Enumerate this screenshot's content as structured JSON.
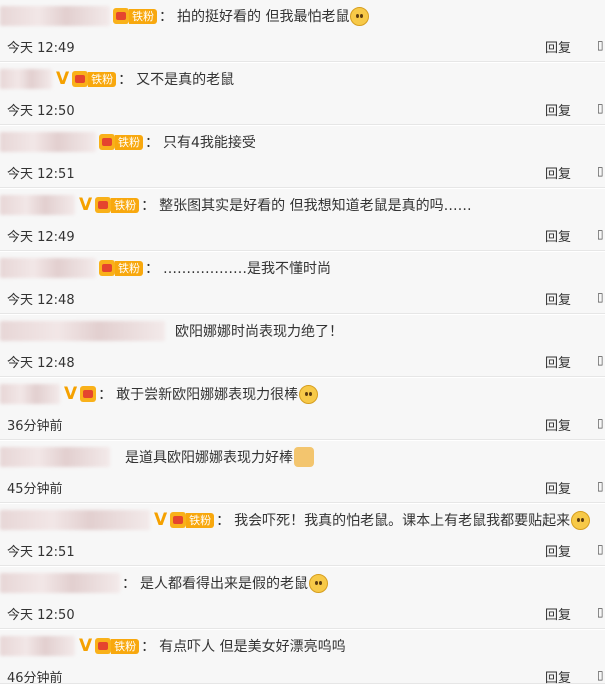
{
  "fan_badge_text": "铁粉",
  "v_badge": "V",
  "reply_label": "回复",
  "thumb_glyph": "▯",
  "comments": [
    {
      "text": "拍的挺好看的 但我最怕老鼠",
      "time": "今天 12:49",
      "v": false,
      "fan": true
    },
    {
      "text": "又不是真的老鼠",
      "time": "今天 12:50",
      "v": true,
      "fan": true
    },
    {
      "text": "只有4我能接受",
      "time": "今天 12:51",
      "v": false,
      "fan": true
    },
    {
      "text": "整张图其实是好看的 但我想知道老鼠是真的吗……",
      "time": "今天 12:49",
      "v": true,
      "fan": true
    },
    {
      "text": "………………是我不懂时尚",
      "time": "今天 12:48",
      "v": false,
      "fan": true
    },
    {
      "text": "欧阳娜娜时尚表现力绝了！",
      "time": "今天 12:48",
      "v": false,
      "fan": false
    },
    {
      "text": "敢于尝新欧阳娜娜表现力很棒",
      "time": "36分钟前",
      "v": true,
      "fan": true
    },
    {
      "text": "是道具欧阳娜娜表现力好棒",
      "time": "45分钟前",
      "v": false,
      "fan": false
    },
    {
      "text": "我会吓死！我真的怕老鼠。课本上有老鼠我都要贴起来",
      "time": "今天 12:51",
      "v": true,
      "fan": true
    },
    {
      "text": "是人都看得出来是假的老鼠",
      "time": "今天 12:50",
      "v": false,
      "fan": false
    },
    {
      "text": "有点吓人 但是美女好漂亮呜呜",
      "time": "46分钟前",
      "v": true,
      "fan": true
    }
  ]
}
